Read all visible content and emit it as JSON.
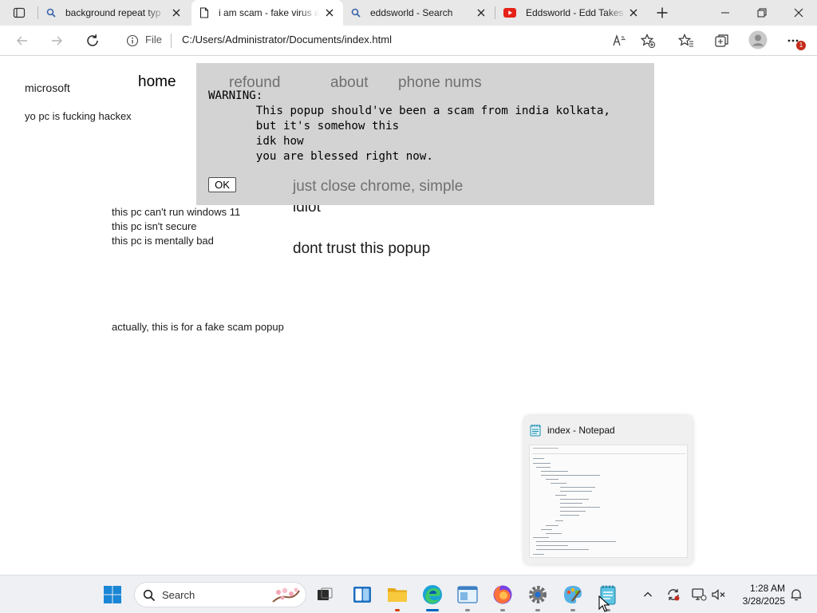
{
  "browser": {
    "tabs": [
      {
        "title": "background repeat typ",
        "icon": "search-icon",
        "active": false
      },
      {
        "title": "i am scam - fake virus a",
        "icon": "page-icon",
        "active": true
      },
      {
        "title": "eddsworld - Search",
        "icon": "search-icon",
        "active": false
      },
      {
        "title": "Eddsworld - Edd Takes",
        "icon": "youtube-icon",
        "active": false
      }
    ],
    "address": {
      "scheme_label": "File",
      "url": "C:/Users/Administrator/Documents/index.html"
    },
    "notification_badge": "1"
  },
  "page": {
    "brand": "microsoft",
    "hacked": "yo pc is fucking hackex",
    "nav": {
      "home": "home",
      "refound": "refound",
      "about": "about",
      "phone": "phone nums"
    },
    "alert": {
      "text": "WARNING:\n       This popup should've been a scam from india kolkata,\n       but it's somehow this\n       idk how\n       you are blessed right now.",
      "ok_label": "OK"
    },
    "close_hint": "just close chrome, simple",
    "idiot": "idiot",
    "dont_trust": "dont trust this popup",
    "pc_lines": [
      "this pc can't run windows 11",
      "this pc isn't secure",
      "this pc is mentally bad"
    ],
    "actually": "actually, this is for a fake scam popup"
  },
  "notepad_preview": {
    "title": "index - Notepad"
  },
  "taskbar": {
    "search_label": "Search",
    "time": "1:28 AM",
    "date": "3/28/2025"
  },
  "colors": {
    "popup_bg": "#d3d3d3",
    "muted_link": "#707070",
    "accent": "#0067c0"
  }
}
